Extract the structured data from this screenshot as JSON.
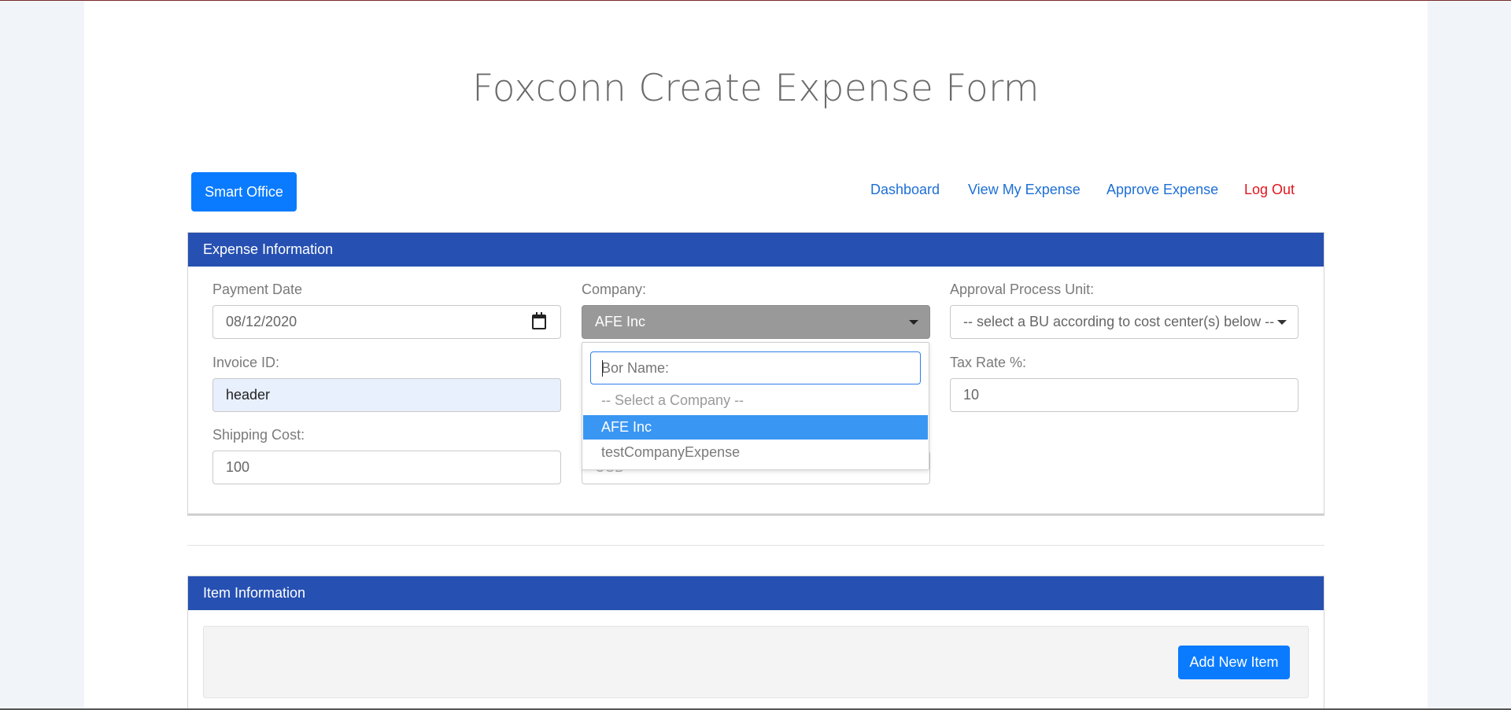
{
  "page": {
    "title": "Foxconn Create Expense Form"
  },
  "header": {
    "brand_label": "Smart Office",
    "nav": {
      "dashboard": "Dashboard",
      "view_my_expense": "View My Expense",
      "approve_expense": "Approve Expense",
      "logout": "Log Out"
    }
  },
  "expense_panel": {
    "heading": "Expense Information",
    "payment_date": {
      "label": "Payment Date",
      "value": "08/12/2020"
    },
    "company": {
      "label": "Company:",
      "value": "AFE Inc"
    },
    "approval_unit": {
      "label": "Approval Process Unit:",
      "value": "-- select a BU according to cost center(s) below --"
    },
    "invoice_id": {
      "label": "Invoice ID:",
      "value": "header"
    },
    "tax_rate": {
      "label": "Tax Rate %:",
      "value": "10"
    },
    "shipping_cost": {
      "label": "Shipping Cost:",
      "value": "100"
    },
    "currency": {
      "value": "USD"
    },
    "company_dropdown": {
      "search_placeholder": "Bor Name:",
      "options": [
        {
          "label": "-- Select a Company --",
          "state": "placeholder"
        },
        {
          "label": "AFE Inc",
          "state": "highlighted"
        },
        {
          "label": "testCompanyExpense",
          "state": "normal"
        }
      ]
    }
  },
  "item_panel": {
    "heading": "Item Information",
    "add_button": "Add New Item"
  },
  "colors": {
    "primary": "#0a7bff",
    "panel_header": "#2650b2",
    "logout": "#e0161d",
    "link": "#1d6fd6",
    "highlight": "#3a96f3"
  }
}
